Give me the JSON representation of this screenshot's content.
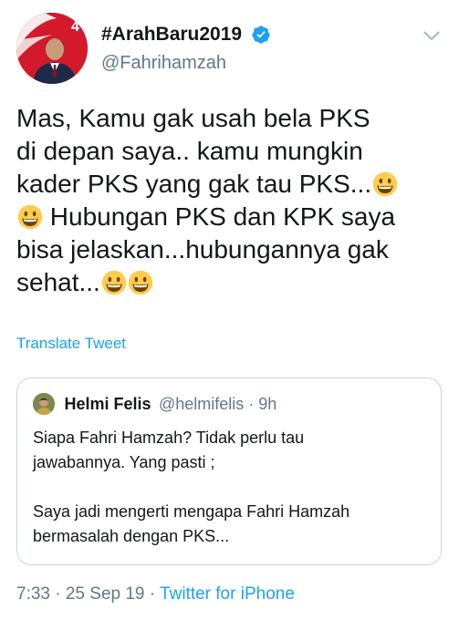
{
  "author": {
    "display_name": "#ArahBaru2019",
    "handle": "@Fahrihamzah",
    "verified": true,
    "avatar_icon": "profile-photo"
  },
  "tweet": {
    "lines": [
      {
        "text": "Mas, Kamu gak usah bela PKS",
        "emoji_after": 0
      },
      {
        "text": "di depan saya.. kamu mungkin",
        "emoji_after": 0
      },
      {
        "text": "kader PKS yang  gak tau PKS...",
        "emoji_after": 1
      },
      {
        "text": " Hubungan PKS dan KPK saya",
        "emoji_before": 1,
        "emoji_after": 0
      },
      {
        "text": "bisa jelaskan...hubungannya gak",
        "emoji_after": 0
      },
      {
        "text": "sehat...",
        "emoji_after": 2
      }
    ],
    "emoji_name": "grinning-face-with-big-eyes"
  },
  "translate_label": "Translate Tweet",
  "quoted": {
    "display_name": "Helmi Felis",
    "handle_time": "@helmifelis · 9h",
    "lines": [
      "Siapa Fahri Hamzah? Tidak perlu tau",
      "jawabannya. Yang pasti ;",
      "",
      "Saya jadi mengerti mengapa Fahri Hamzah",
      "bermasalah dengan PKS..."
    ]
  },
  "meta": {
    "time_date": "7:33 · 25 Sep 19 · ",
    "source": "Twitter for iPhone"
  },
  "colors": {
    "link": "#1da1f2",
    "secondary": "#657786",
    "text": "#14171a",
    "border": "#ccd6dd"
  }
}
